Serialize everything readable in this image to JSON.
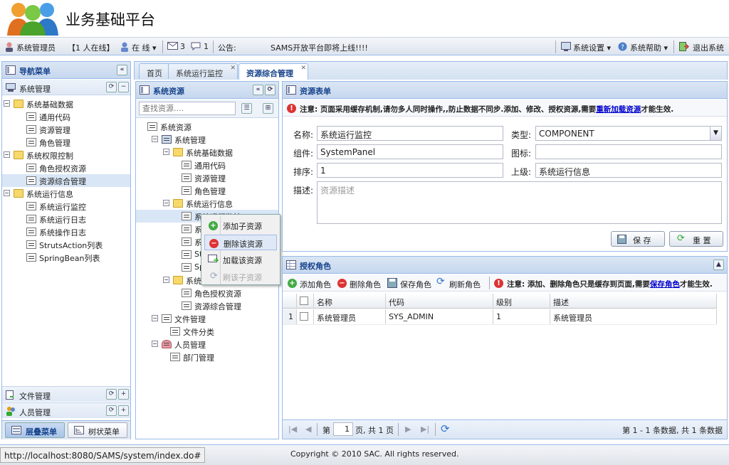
{
  "header": {
    "title": "业务基础平台"
  },
  "infobar": {
    "user": "系统管理员",
    "online_count": "【1 人在线】",
    "status": "在 线",
    "messages": "3",
    "comments": "1",
    "notice_label": "公告:",
    "notice_text": "SAMS开放平台即将上线!!!!",
    "settings": "系统设置",
    "help": "系统帮助",
    "logout": "退出系统"
  },
  "nav": {
    "title": "导航菜单",
    "section": "系统管理",
    "tree": [
      {
        "label": "系统基础数据"
      },
      {
        "label": "通用代码"
      },
      {
        "label": "资源管理"
      },
      {
        "label": "角色管理"
      },
      {
        "label": "系统权限控制"
      },
      {
        "label": "角色授权资源"
      },
      {
        "label": "资源综合管理"
      },
      {
        "label": "系统运行信息"
      },
      {
        "label": "系统运行监控"
      },
      {
        "label": "系统运行日志"
      },
      {
        "label": "系统操作日志"
      },
      {
        "label": "StrutsAction列表"
      },
      {
        "label": "SpringBean列表"
      }
    ],
    "file_mgmt": "文件管理",
    "people_mgmt": "人员管理",
    "tab_stacked": "层叠菜单",
    "tab_tree": "树状菜单"
  },
  "tabs": [
    {
      "label": "首页"
    },
    {
      "label": "系统运行监控"
    },
    {
      "label": "资源综合管理"
    }
  ],
  "resources": {
    "title": "系统资源",
    "search_placeholder": "查找资源....",
    "tree": [
      {
        "label": "系统资源"
      },
      {
        "label": "系统管理"
      },
      {
        "label": "系统基础数据"
      },
      {
        "label": "通用代码"
      },
      {
        "label": "资源管理"
      },
      {
        "label": "角色管理"
      },
      {
        "label": "系统运行信息"
      },
      {
        "label": "系统运行监控"
      },
      {
        "label": "系"
      },
      {
        "label": "系"
      },
      {
        "label": "St"
      },
      {
        "label": "Sp"
      },
      {
        "label": "系统"
      },
      {
        "label": "角色授权资源"
      },
      {
        "label": "资源综合管理"
      },
      {
        "label": "文件管理"
      },
      {
        "label": "文件分类"
      },
      {
        "label": "人员管理"
      },
      {
        "label": "部门管理"
      }
    ],
    "context_menu": [
      {
        "label": "添加子资源"
      },
      {
        "label": "删除该资源"
      },
      {
        "label": "加载该资源"
      },
      {
        "label": "刷该子资源"
      }
    ]
  },
  "form": {
    "title": "资源表单",
    "notice_strong": "注意:",
    "notice_text": "页面采用缓存机制,请勿多人同时操作,,防止数据不同步.添加、修改、授权资源,需要",
    "notice_link": "重新加载资源",
    "notice_end": "才能生效.",
    "name_label": "名称:",
    "name_value": "系统运行监控",
    "type_label": "类型:",
    "type_value": "COMPONENT",
    "component_label": "组件:",
    "component_value": "SystemPanel",
    "icon_label": "图标:",
    "icon_value": "",
    "order_label": "排序:",
    "order_value": "1",
    "parent_label": "上级:",
    "parent_value": "系统运行信息",
    "desc_label": "描述:",
    "desc_placeholder": "资源描述",
    "save": "保 存",
    "reset": "重 置"
  },
  "roles": {
    "title": "授权角色",
    "add": "添加角色",
    "remove": "删除角色",
    "save": "保存角色",
    "refresh": "刷新角色",
    "notice_strong": "注意:",
    "notice_text": "添加、删除角色只是缓存到页面,需要",
    "notice_link": "保存角色",
    "notice_end": "才能生效.",
    "columns": [
      "名称",
      "代码",
      "级别",
      "描述"
    ],
    "rows": [
      {
        "num": "1",
        "name": "系统管理员",
        "code": "SYS_ADMIN",
        "level": "1",
        "desc": "系统管理员"
      }
    ],
    "pager_page": "第",
    "pager_current": "1",
    "pager_total": "页, 共 1 页",
    "pager_info": "第 1 - 1 条数据, 共 1 条数据"
  },
  "status": {
    "url": "http://localhost:8080/SAMS/system/index.do#",
    "copyright": "Copyright © 2010 SAC. All rights reserved."
  },
  "colors": {
    "panel_border": "#99bbe8",
    "header_text": "#15428b",
    "link": "#0000cc",
    "warning": "#d33"
  }
}
